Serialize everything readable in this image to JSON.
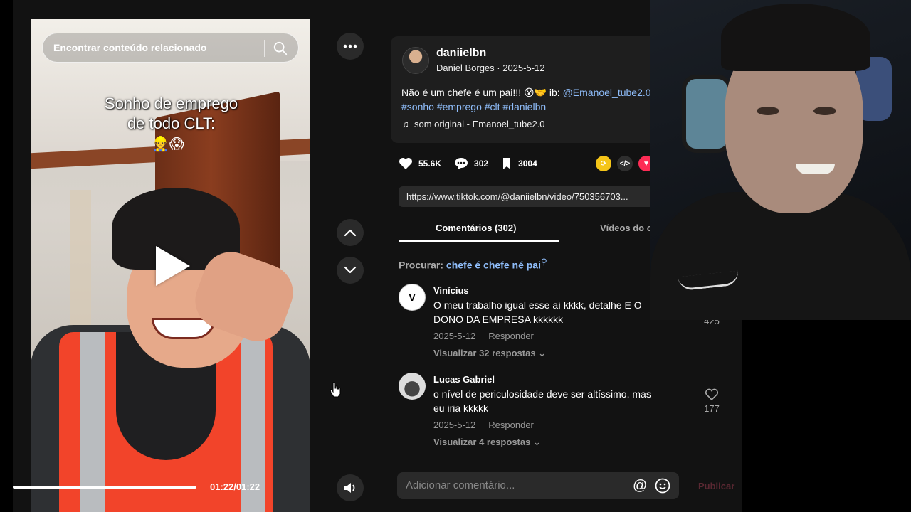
{
  "video": {
    "search_placeholder": "Encontrar conteúdo relacionado",
    "caption_line1": "Sonho de emprego",
    "caption_line2": "de todo CLT:",
    "caption_emoji": "👷😱",
    "time": "01:22/01:22",
    "progress": 1.0
  },
  "post": {
    "handle": "daniielbn",
    "meta": "Daniel Borges · 2025-5-12",
    "desc_text": "Não é um chefe é um pai!!! 😰🤝 ib: ",
    "desc_mention": "@Emanoel_tube2.0",
    "hashtags": "#sonho #emprego #clt #danielbn",
    "music": "som original - Emanoel_tube2.0",
    "likes": "55.6K",
    "comments": "302",
    "saves": "3004",
    "url": "https://www.tiktok.com/@daniielbn/video/750356703..."
  },
  "tabs": {
    "comments": "Comentários (302)",
    "videos": "Vídeos do c"
  },
  "related_search": {
    "label": "Procurar:",
    "query": "chefe é chefe né pai"
  },
  "comments": [
    {
      "user": "Vinícius",
      "text": "O meu trabalho igual esse aí kkkk, detalhe E O DONO DA EMPRESA kkkkkk",
      "date": "2025-5-12",
      "reply": "Responder",
      "replies": "Visualizar 32 respostas ⌄",
      "likes": "425",
      "avatar_letter": "V"
    },
    {
      "user": "Lucas Gabriel",
      "text": "o nível de periculosidade deve ser altíssimo, mas eu iria kkkkk",
      "date": "2025-5-12",
      "reply": "Responder",
      "replies": "Visualizar 4 respostas ⌄",
      "likes": "177"
    }
  ],
  "composer": {
    "placeholder": "Adicionar comentário...",
    "at": "@",
    "publish": "Publicar"
  },
  "colors": {
    "link": "#8fbdfa",
    "panel_bg": "#121212",
    "publish_disabled": "#5a2832"
  }
}
